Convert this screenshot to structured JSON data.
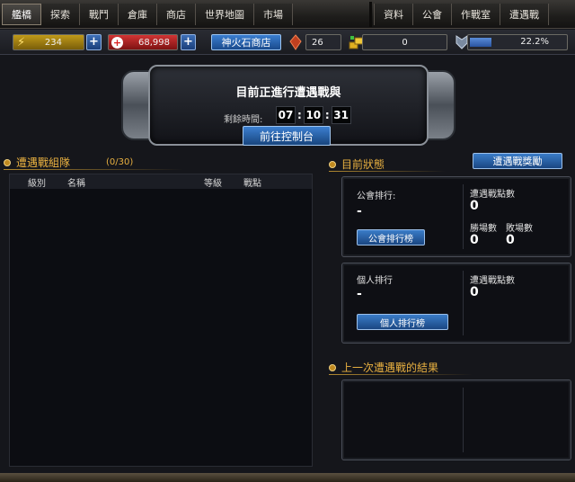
{
  "nav_left": [
    "艦橋",
    "探索",
    "戰鬥",
    "倉庫",
    "商店",
    "世界地圖",
    "市場"
  ],
  "nav_right": [
    "資料",
    "公會",
    "作戰室",
    "遭遇戰"
  ],
  "resources": {
    "energy": "234",
    "hp": "68,998",
    "shop_label": "神火石商店",
    "gem": "26",
    "gold": "0",
    "exp": "22.2%",
    "exp_fraction": 0.222
  },
  "banner": {
    "title": "目前正進行遭遇戰與",
    "timer_label": "剩餘時間:",
    "hours": "07",
    "minutes": "10",
    "seconds": "31",
    "button": "前往控制台"
  },
  "party": {
    "title": "遭遇戰組隊",
    "count": "(0/30)",
    "columns": [
      "級別",
      "名稱",
      "等級",
      "戰點"
    ]
  },
  "status": {
    "title": "目前狀態",
    "reward_button": "遭遇戰獎勵",
    "guild": {
      "rank_label": "公會排行:",
      "rank_value": "-",
      "button": "公會排行榜",
      "points_label": "遭遇戰點數",
      "points_value": "0",
      "wins_label": "勝場數",
      "wins_value": "0",
      "losses_label": "敗場數",
      "losses_value": "0"
    },
    "personal": {
      "rank_label": "個人排行",
      "rank_value": "-",
      "button": "個人排行榜",
      "points_label": "遭遇戰點數",
      "points_value": "0"
    }
  },
  "last_result": {
    "title": "上一次遭遇戰的結果"
  }
}
